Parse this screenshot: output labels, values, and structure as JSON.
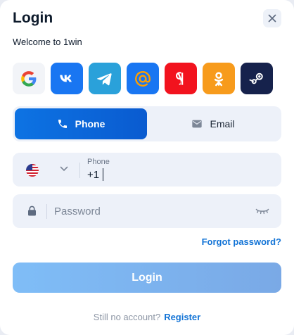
{
  "login": {
    "title": "Login",
    "subtitle": "Welcome to 1win",
    "close_icon": "close-icon"
  },
  "social_buttons": [
    {
      "name": "google",
      "icon": "google-icon",
      "bg": "#f2f4f8"
    },
    {
      "name": "vk",
      "icon": "vk-icon",
      "bg": "#1976f2"
    },
    {
      "name": "telegram",
      "icon": "telegram-icon",
      "bg": "#2aa1da"
    },
    {
      "name": "mail",
      "icon": "mail-at-icon",
      "bg": "#1976f2"
    },
    {
      "name": "yandex",
      "icon": "yandex-icon",
      "bg": "#f2131e"
    },
    {
      "name": "odnoklassniki",
      "icon": "odnoklassniki-icon",
      "bg": "#f79b1c"
    },
    {
      "name": "steam",
      "icon": "steam-icon",
      "bg": "#16224c"
    }
  ],
  "method_switch": {
    "phone_label": "Phone",
    "email_label": "Email",
    "active": "Phone"
  },
  "phone_field": {
    "label": "Phone",
    "value": "+1",
    "country_icon": "us-flag-icon"
  },
  "password_field": {
    "placeholder": "Password"
  },
  "forgot_password": "Forgot password?",
  "login_button": "Login",
  "footer": {
    "prompt": "Still no account?",
    "register": "Register"
  },
  "colors": {
    "accent": "#1374d6",
    "active_tab": "#0d73e3",
    "field_bg": "#edf1f9"
  }
}
